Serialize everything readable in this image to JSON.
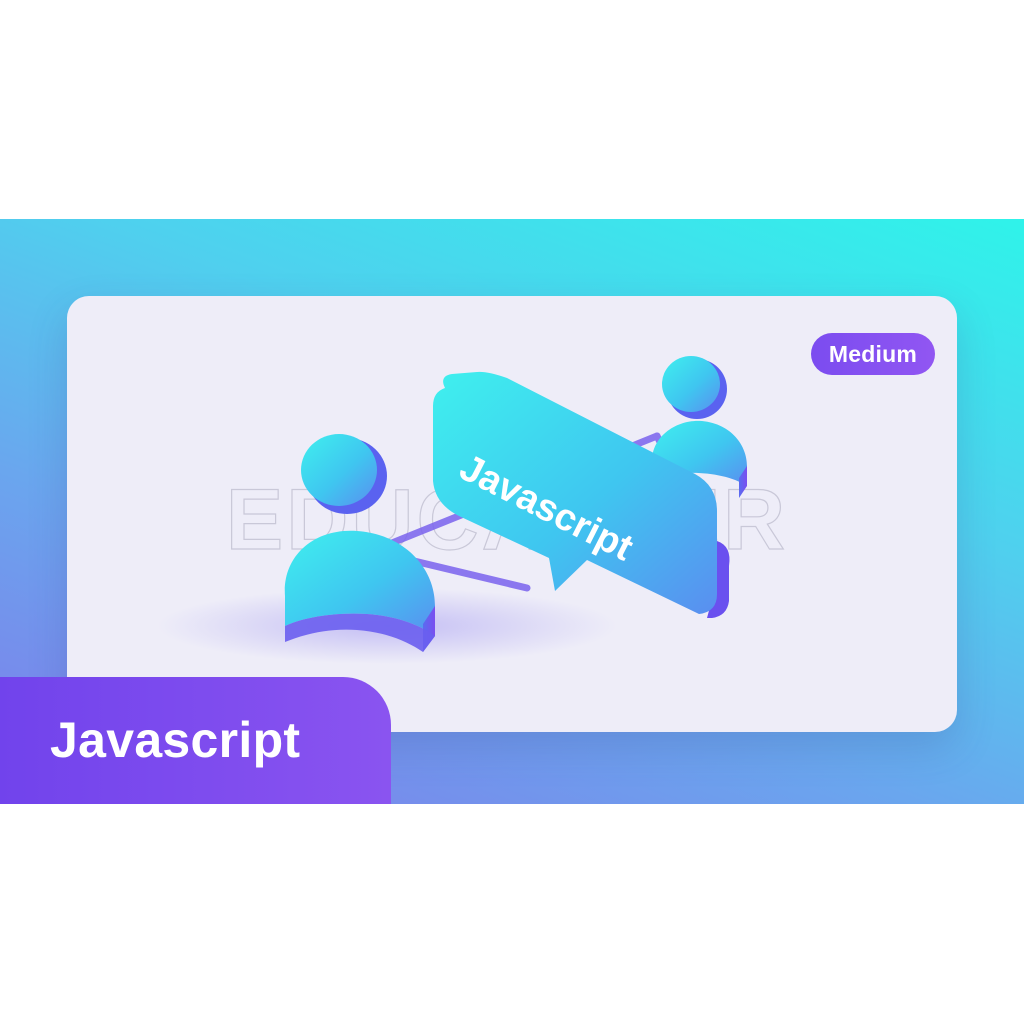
{
  "badge": {
    "label": "Medium"
  },
  "title": {
    "label": "Javascript"
  },
  "bubble": {
    "label": "Javascript"
  },
  "watermark": {
    "label": "EDUCASTER"
  },
  "icons": {
    "left": "person-icon",
    "right": "person-icon",
    "center": "speech-bubble-icon"
  },
  "colors": {
    "banner_top": "#2ff3ea",
    "banner_bottom": "#7f7bea",
    "card_bg": "#eeedf8",
    "badge_bg": "#7b4cf0",
    "title_bg": "#7143ec",
    "cyan": "#34d8ee",
    "purple": "#7b5ef0"
  }
}
